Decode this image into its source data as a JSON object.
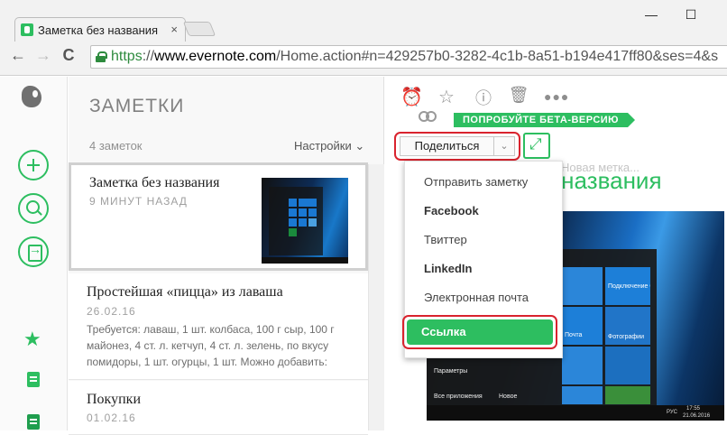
{
  "browser": {
    "tab_title": "Заметка без названия",
    "tab_close": "×",
    "minimize": "—",
    "maximize": "☐",
    "back": "←",
    "forward": "→",
    "reload": "C",
    "url_scheme": "https",
    "url_sep": "://",
    "url_host": "www.evernote.com",
    "url_path": "/Home.action#n=429257b0-3282-4c1b-8a51-b194e417ff80&ses=4&s"
  },
  "notelist": {
    "heading": "ЗАМЕТКИ",
    "count": "4 заметок",
    "settings": "Настройки ⌄",
    "notes": [
      {
        "title": "Заметка без названия",
        "date": "9 МИНУТ НАЗАД",
        "snippet": ""
      },
      {
        "title": "Простейшая «пицца» из лаваша",
        "date": "26.02.16",
        "snippet": "Требуется: лаваш, 1 шт. колбаса, 100 г сыр, 100 г майонез, 4 ст. л. кетчуп, 4 ст. л. зелень, по вкусу помидоры, 1 шт. огурцы, 1 шт. Можно добавить:"
      },
      {
        "title": "Покупки",
        "date": "01.02.16",
        "snippet": ""
      }
    ]
  },
  "detail": {
    "toolbar_icons": [
      "reminder-icon",
      "star-icon",
      "info-icon",
      "trash-icon",
      "more-icon"
    ],
    "beta_label": "ПОПРОБУЙТЕ БЕТА-ВЕРСИЮ",
    "share_label": "Поделиться",
    "share_caret": "⌄",
    "new_tag": "Новая метка...",
    "note_title_fragment": "з названия"
  },
  "share_menu": {
    "items": [
      "Отправить заметку",
      "Facebook",
      "Твиттер",
      "LinkedIn",
      "Электронная почта",
      "Ссылка"
    ]
  },
  "screenshot": {
    "tile_outlook": "Подключение Outlook",
    "tile_mail": "Почта",
    "tile_photos": "Фотографии",
    "settings": "Параметры",
    "all_apps": "Все приложения",
    "new": "Новое",
    "time": "17:55",
    "date": "21.06.2016",
    "lang": "РУС"
  },
  "colors": {
    "accent": "#2dbe60",
    "highlight": "#d9232e"
  }
}
